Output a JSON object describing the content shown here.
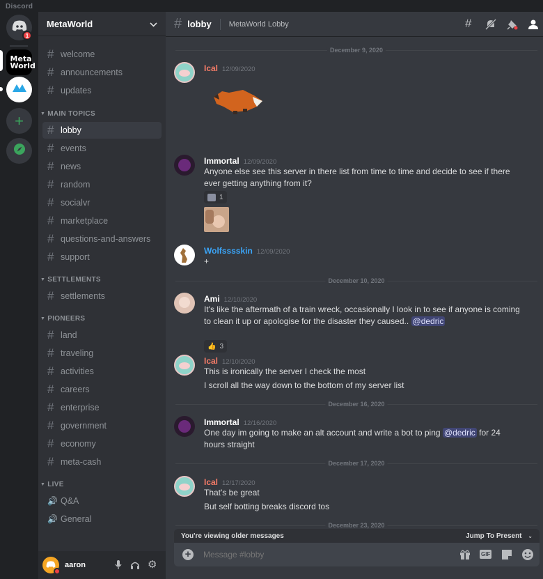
{
  "window": {
    "title": "Discord"
  },
  "guilds": {
    "home_badge": "1",
    "metaworld_logo": "Meta World"
  },
  "server": {
    "name": "MetaWorld"
  },
  "channels_top": [
    "welcome",
    "announcements",
    "updates"
  ],
  "categories": {
    "main_topics": {
      "label": "MAIN TOPICS",
      "channels": [
        "lobby",
        "events",
        "news",
        "random",
        "socialvr",
        "marketplace",
        "questions-and-answers",
        "support"
      ]
    },
    "settlements": {
      "label": "SETTLEMENTS",
      "channels": [
        "settlements"
      ]
    },
    "pioneers": {
      "label": "PIONEERS",
      "channels": [
        "land",
        "traveling",
        "activities",
        "careers",
        "enterprise",
        "government",
        "economy",
        "meta-cash"
      ]
    },
    "live": {
      "label": "LIVE",
      "voice_channels": [
        "Q&A",
        "General"
      ]
    }
  },
  "user": {
    "name": "aaron"
  },
  "header": {
    "channel": "lobby",
    "topic": "MetaWorld Lobby"
  },
  "dates": [
    "December 9, 2020",
    "December 10, 2020",
    "December 16, 2020",
    "December 17, 2020",
    "December 23, 2020"
  ],
  "messages": [
    {
      "author": "Ical",
      "time": "12/09/2020",
      "color": "#f47b67"
    },
    {
      "author": "Immortal",
      "time": "12/09/2020",
      "color": "#ffffff",
      "text": "Anyone else see this server in there list from time to time and decide to see if there ever getting anything from it?",
      "reaction_count": "1"
    },
    {
      "author": "Wolfsssskin",
      "time": "12/09/2020",
      "color": "#3ba5f8",
      "text": "+"
    },
    {
      "author": "Ami",
      "time": "12/10/2020",
      "color": "#ffffff",
      "text": "It's like the aftermath of a train wreck, occasionally I look in to see if anyone is coming to clean it up or apologise for the disaster they caused..",
      "mention": "@dedric",
      "reaction_count": "3"
    },
    {
      "author": "Ical",
      "time": "12/10/2020",
      "color": "#f47b67",
      "lines": [
        "This is ironically the server I check the most",
        "I scroll all the way down to the bottom of my server list"
      ]
    },
    {
      "author": "Immortal",
      "time": "12/16/2020",
      "color": "#ffffff",
      "text_before": "One day im going to make an alt account and write a bot to ping",
      "mention": "@dedric",
      "text_after": "for 24 hours straight"
    },
    {
      "author": "Ical",
      "time": "12/17/2020",
      "color": "#f47b67",
      "lines": [
        "That's be great",
        "But self botting breaks discord tos"
      ]
    }
  ],
  "older_bar": {
    "text": "You're viewing older messages",
    "jump": "Jump To Present"
  },
  "composer": {
    "placeholder": "Message #lobby",
    "gif": "GIF"
  }
}
